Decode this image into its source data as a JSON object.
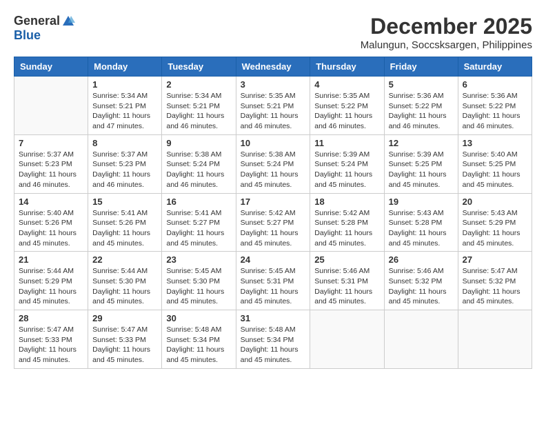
{
  "logo": {
    "general": "General",
    "blue": "Blue"
  },
  "title": {
    "month_year": "December 2025",
    "location": "Malungun, Soccsksargen, Philippines"
  },
  "weekdays": [
    "Sunday",
    "Monday",
    "Tuesday",
    "Wednesday",
    "Thursday",
    "Friday",
    "Saturday"
  ],
  "weeks": [
    [
      {
        "day": "",
        "info": ""
      },
      {
        "day": "1",
        "info": "Sunrise: 5:34 AM\nSunset: 5:21 PM\nDaylight: 11 hours\nand 47 minutes."
      },
      {
        "day": "2",
        "info": "Sunrise: 5:34 AM\nSunset: 5:21 PM\nDaylight: 11 hours\nand 46 minutes."
      },
      {
        "day": "3",
        "info": "Sunrise: 5:35 AM\nSunset: 5:21 PM\nDaylight: 11 hours\nand 46 minutes."
      },
      {
        "day": "4",
        "info": "Sunrise: 5:35 AM\nSunset: 5:22 PM\nDaylight: 11 hours\nand 46 minutes."
      },
      {
        "day": "5",
        "info": "Sunrise: 5:36 AM\nSunset: 5:22 PM\nDaylight: 11 hours\nand 46 minutes."
      },
      {
        "day": "6",
        "info": "Sunrise: 5:36 AM\nSunset: 5:22 PM\nDaylight: 11 hours\nand 46 minutes."
      }
    ],
    [
      {
        "day": "7",
        "info": "Sunrise: 5:37 AM\nSunset: 5:23 PM\nDaylight: 11 hours\nand 46 minutes."
      },
      {
        "day": "8",
        "info": "Sunrise: 5:37 AM\nSunset: 5:23 PM\nDaylight: 11 hours\nand 46 minutes."
      },
      {
        "day": "9",
        "info": "Sunrise: 5:38 AM\nSunset: 5:24 PM\nDaylight: 11 hours\nand 46 minutes."
      },
      {
        "day": "10",
        "info": "Sunrise: 5:38 AM\nSunset: 5:24 PM\nDaylight: 11 hours\nand 45 minutes."
      },
      {
        "day": "11",
        "info": "Sunrise: 5:39 AM\nSunset: 5:24 PM\nDaylight: 11 hours\nand 45 minutes."
      },
      {
        "day": "12",
        "info": "Sunrise: 5:39 AM\nSunset: 5:25 PM\nDaylight: 11 hours\nand 45 minutes."
      },
      {
        "day": "13",
        "info": "Sunrise: 5:40 AM\nSunset: 5:25 PM\nDaylight: 11 hours\nand 45 minutes."
      }
    ],
    [
      {
        "day": "14",
        "info": "Sunrise: 5:40 AM\nSunset: 5:26 PM\nDaylight: 11 hours\nand 45 minutes."
      },
      {
        "day": "15",
        "info": "Sunrise: 5:41 AM\nSunset: 5:26 PM\nDaylight: 11 hours\nand 45 minutes."
      },
      {
        "day": "16",
        "info": "Sunrise: 5:41 AM\nSunset: 5:27 PM\nDaylight: 11 hours\nand 45 minutes."
      },
      {
        "day": "17",
        "info": "Sunrise: 5:42 AM\nSunset: 5:27 PM\nDaylight: 11 hours\nand 45 minutes."
      },
      {
        "day": "18",
        "info": "Sunrise: 5:42 AM\nSunset: 5:28 PM\nDaylight: 11 hours\nand 45 minutes."
      },
      {
        "day": "19",
        "info": "Sunrise: 5:43 AM\nSunset: 5:28 PM\nDaylight: 11 hours\nand 45 minutes."
      },
      {
        "day": "20",
        "info": "Sunrise: 5:43 AM\nSunset: 5:29 PM\nDaylight: 11 hours\nand 45 minutes."
      }
    ],
    [
      {
        "day": "21",
        "info": "Sunrise: 5:44 AM\nSunset: 5:29 PM\nDaylight: 11 hours\nand 45 minutes."
      },
      {
        "day": "22",
        "info": "Sunrise: 5:44 AM\nSunset: 5:30 PM\nDaylight: 11 hours\nand 45 minutes."
      },
      {
        "day": "23",
        "info": "Sunrise: 5:45 AM\nSunset: 5:30 PM\nDaylight: 11 hours\nand 45 minutes."
      },
      {
        "day": "24",
        "info": "Sunrise: 5:45 AM\nSunset: 5:31 PM\nDaylight: 11 hours\nand 45 minutes."
      },
      {
        "day": "25",
        "info": "Sunrise: 5:46 AM\nSunset: 5:31 PM\nDaylight: 11 hours\nand 45 minutes."
      },
      {
        "day": "26",
        "info": "Sunrise: 5:46 AM\nSunset: 5:32 PM\nDaylight: 11 hours\nand 45 minutes."
      },
      {
        "day": "27",
        "info": "Sunrise: 5:47 AM\nSunset: 5:32 PM\nDaylight: 11 hours\nand 45 minutes."
      }
    ],
    [
      {
        "day": "28",
        "info": "Sunrise: 5:47 AM\nSunset: 5:33 PM\nDaylight: 11 hours\nand 45 minutes."
      },
      {
        "day": "29",
        "info": "Sunrise: 5:47 AM\nSunset: 5:33 PM\nDaylight: 11 hours\nand 45 minutes."
      },
      {
        "day": "30",
        "info": "Sunrise: 5:48 AM\nSunset: 5:34 PM\nDaylight: 11 hours\nand 45 minutes."
      },
      {
        "day": "31",
        "info": "Sunrise: 5:48 AM\nSunset: 5:34 PM\nDaylight: 11 hours\nand 45 minutes."
      },
      {
        "day": "",
        "info": ""
      },
      {
        "day": "",
        "info": ""
      },
      {
        "day": "",
        "info": ""
      }
    ]
  ]
}
